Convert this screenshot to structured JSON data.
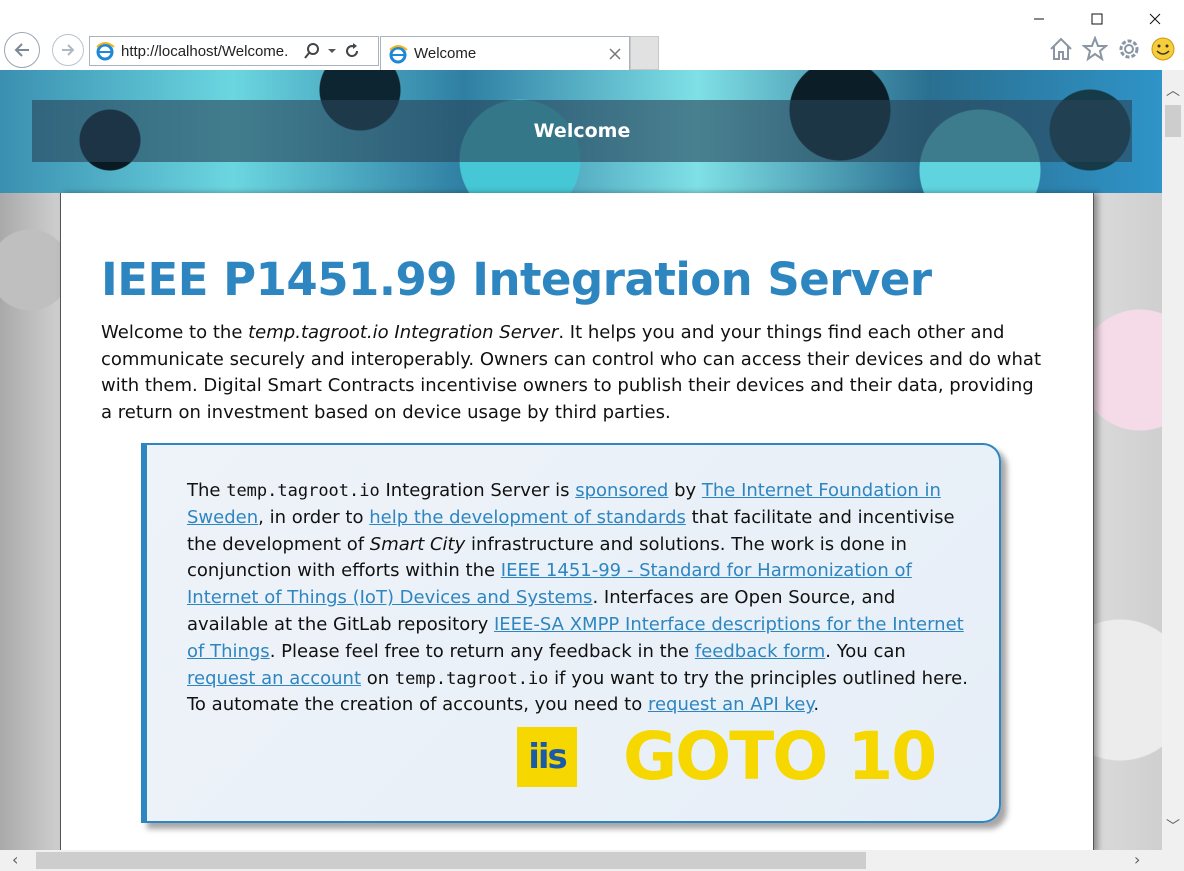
{
  "browser": {
    "address_url": "http://localhost/Welcome.",
    "tab_title": "Welcome"
  },
  "banner": {
    "title": "Welcome"
  },
  "page": {
    "heading": "IEEE P1451.99 Integration Server",
    "intro": {
      "t1": "Welcome to the ",
      "em1": "temp.tagroot.io Integration Server",
      "t2": ". It helps you and your things find each other and communicate securely and interoperably. Owners can control who can access their devices and do what with them. Digital Smart Contracts incentivise owners to publish their devices and their data, providing a return on investment based on device usage by third parties."
    },
    "panel": {
      "t1": "The ",
      "code1": "temp.tagroot.io",
      "t2": " Integration Server is ",
      "link_sponsored": "sponsored",
      "t3": " by ",
      "link_foundation": "The Internet Foundation in Sweden",
      "t4": ", in order to ",
      "link_standards": "help the development of standards",
      "t5": " that facilitate and incentivise the development of ",
      "em1": "Smart City",
      "t6": " infrastructure and solutions. The work is done in conjunction with efforts within the ",
      "link_ieee": "IEEE 1451-99 - Standard for Harmonization of Internet of Things (IoT) Devices and Systems",
      "t7": ". Interfaces are Open Source, and available at the GitLab repository ",
      "link_gitlab": "IEEE-SA XMPP Interface descriptions for the Internet of Things",
      "t8": ". Please feel free to return any feedback in the ",
      "link_feedback": "feedback form",
      "t9": ". You can ",
      "link_account": "request an account",
      "t10": " on ",
      "code2": "temp.tagroot.io",
      "t11": " if you want to try the principles outlined here. To automate the creation of accounts, you need to ",
      "link_apikey": "request an API key",
      "t12": ".",
      "logo_iis": "iis",
      "logo_goto": "GOTO 10"
    }
  },
  "colors": {
    "accent": "#2e86c1",
    "logo_yellow": "#f6d800"
  },
  "icons": [
    "back-icon",
    "forward-icon",
    "ie-icon",
    "search-icon",
    "dropdown-icon",
    "refresh-icon",
    "close-tab-icon",
    "home-icon",
    "favorites-star-icon",
    "settings-gear-icon",
    "smiley-feedback-icon",
    "minimize-icon",
    "maximize-icon",
    "close-icon"
  ]
}
